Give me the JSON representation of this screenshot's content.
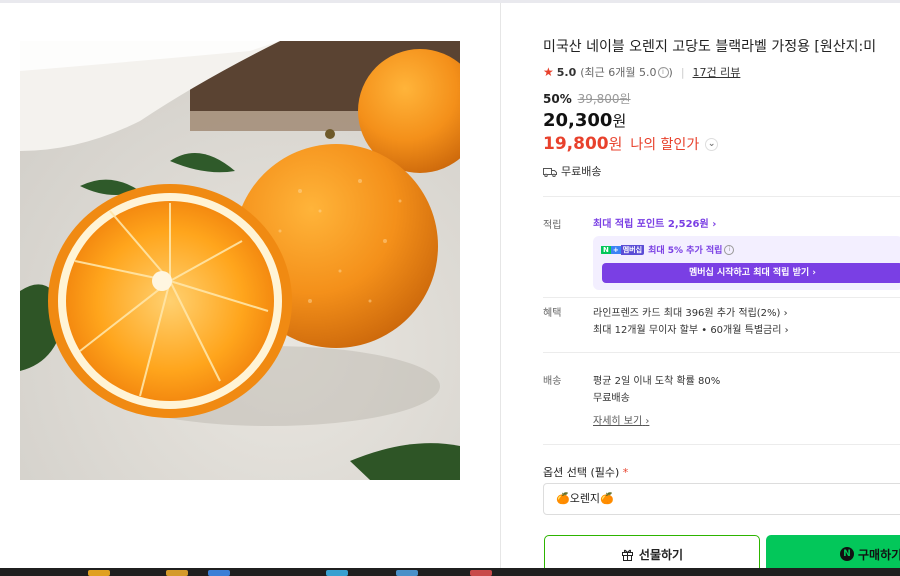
{
  "product": {
    "title": "미국산 네이블 오렌지 고당도 블랙라벨 가정용 [원산지:미",
    "rating": {
      "score": "5.0",
      "recent": "(최근 6개월 5.0",
      "reviews": "17건 리뷰"
    },
    "discount_pct": "50%",
    "original_price": "39,800원",
    "price_number": "20,300",
    "price_unit": "원",
    "my_price_number": "19,800",
    "my_price_unit": "원",
    "my_price_label": "나의 할인가",
    "shipping": "무료배송"
  },
  "points": {
    "label": "적립",
    "link_text": "최대 적립 포인트",
    "amount": "2,526원",
    "npay_badge": [
      "N",
      "+",
      "멤버십"
    ],
    "member_text": "최대 5% 추가 적립",
    "member_button": "멤버십 시작하고 최대 적립 받기"
  },
  "benefit": {
    "label": "혜택",
    "line1": "라인프렌즈 카드 최대 396원 추가 적립(2%)",
    "line2": "최대 12개월 무이자 할부 • 60개월 특별금리"
  },
  "delivery": {
    "label": "배송",
    "line1": "평균 2일 이내 도착 확률 80%",
    "line2": "무료배송",
    "detail_link": "자세히 보기"
  },
  "options": {
    "label": "옵션 선택 (필수)",
    "required_mark": "*",
    "selected": "🍊오렌지🍊"
  },
  "buttons": {
    "gift": "선물하기",
    "buy": "구매하기"
  },
  "colors": {
    "accent_green": "#03c75a",
    "discount_red": "#e8412c",
    "membership_purple": "#7a3fe4"
  },
  "icons": [
    "star-icon",
    "info-icon",
    "truck-icon",
    "chevron-right-icon",
    "gift-icon",
    "naver-n-icon"
  ]
}
